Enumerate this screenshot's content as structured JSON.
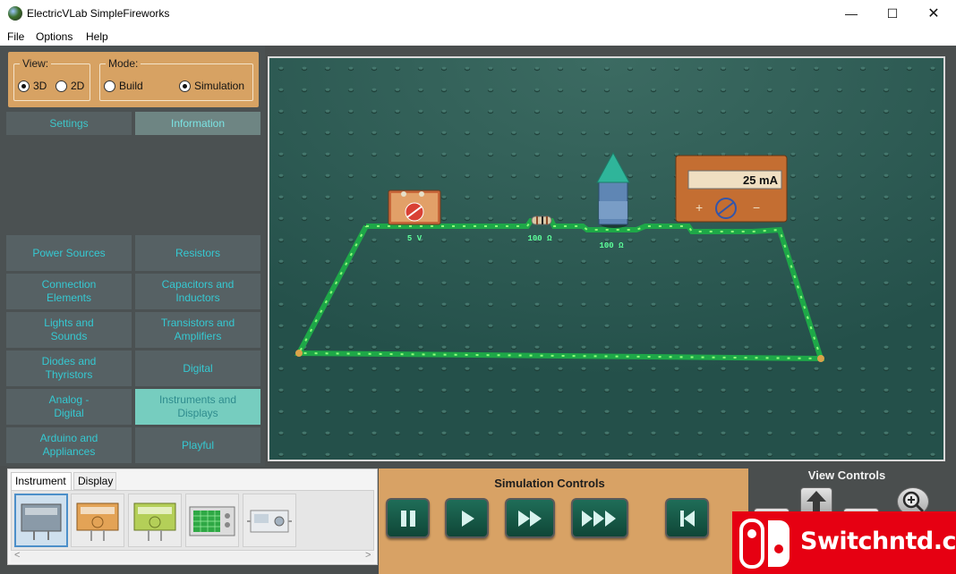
{
  "window": {
    "title": "ElectricVLab  SimpleFireworks",
    "min_glyph": "—",
    "max_glyph": "☐",
    "close_glyph": "✕"
  },
  "menu": [
    "File",
    "Options",
    "Help"
  ],
  "view_group": {
    "title": "View:",
    "options": [
      {
        "label": "3D",
        "selected": true
      },
      {
        "label": "2D",
        "selected": false
      }
    ]
  },
  "mode_group": {
    "title": "Mode:",
    "options": [
      {
        "label": "Build",
        "selected": false
      },
      {
        "label": "Simulation",
        "selected": true
      }
    ]
  },
  "tabs": [
    {
      "label": "Settings",
      "active": false
    },
    {
      "label": "Information",
      "active": true
    }
  ],
  "categories": [
    {
      "label": "Power Sources",
      "active": false
    },
    {
      "label": "Resistors",
      "active": false
    },
    {
      "label": "Connection\nElements",
      "active": false
    },
    {
      "label": "Capacitors and\nInductors",
      "active": false
    },
    {
      "label": "Lights and\nSounds",
      "active": false
    },
    {
      "label": "Transistors and\nAmplifiers",
      "active": false
    },
    {
      "label": "Diodes and\nThyristors",
      "active": false
    },
    {
      "label": "Digital",
      "active": false
    },
    {
      "label": "Analog -\nDigital",
      "active": false
    },
    {
      "label": "Instruments and\nDisplays",
      "active": true
    },
    {
      "label": "Arduino and\nAppliances",
      "active": false
    },
    {
      "label": "Playful",
      "active": false
    }
  ],
  "scene": {
    "battery_label": "5 V",
    "resistor_label": "100 Ω",
    "firework_label": "100 Ω",
    "ammeter_reading": "25 mA"
  },
  "instrument_panel": {
    "tabs": [
      {
        "label": "Instrument",
        "active": true
      },
      {
        "label": "Display",
        "active": false
      }
    ],
    "thumbnails": [
      "ammeter-thumb",
      "orange-meter-thumb",
      "green-meter-thumb",
      "oscilloscope-thumb",
      "generator-thumb"
    ],
    "scroll_left": "<",
    "scroll_right": ">"
  },
  "simulation_controls": {
    "title": "Simulation Controls",
    "buttons": [
      "pause",
      "play",
      "fast-forward",
      "faster-forward",
      "reset"
    ]
  },
  "view_controls": {
    "title": "View Controls"
  },
  "watermark": {
    "text": "Switchntd.com"
  },
  "colors": {
    "accent_orange": "#d8a265",
    "panel_dark": "#4a4e4e",
    "cyan_text": "#35c9d2",
    "board_green": "#2f5e55",
    "wire_green": "#29e05a",
    "watermark_red": "#e60012"
  }
}
